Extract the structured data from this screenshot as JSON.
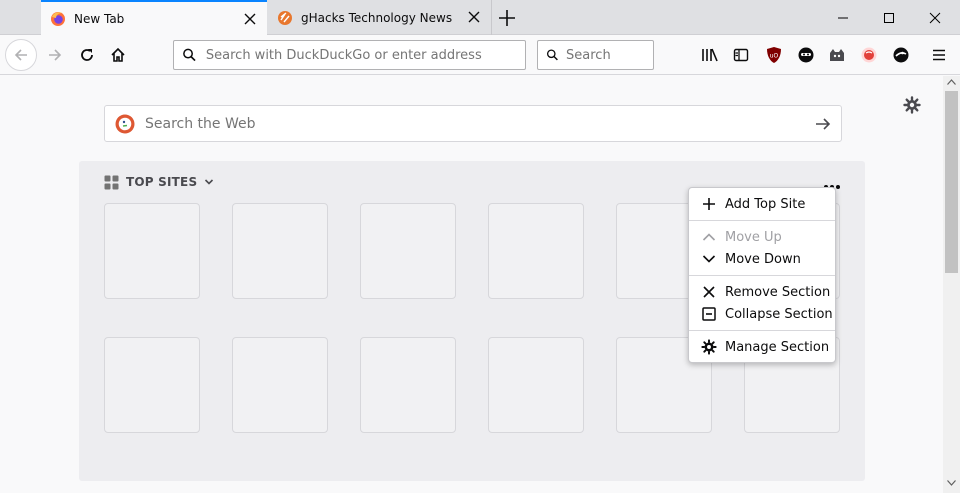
{
  "tabs": [
    {
      "label": "New Tab",
      "active": true
    },
    {
      "label": "gHacks Technology News",
      "active": false
    }
  ],
  "urlbar": {
    "placeholder": "Search with DuckDuckGo or enter address"
  },
  "searchbar": {
    "placeholder": "Search"
  },
  "content": {
    "web_search_placeholder": "Search the Web",
    "top_sites_title": "TOP SITES"
  },
  "context_menu": {
    "items": [
      {
        "label": "Add Top Site",
        "icon": "plus-icon",
        "enabled": true
      },
      {
        "label": "Move Up",
        "icon": "chevron-up-icon",
        "enabled": false
      },
      {
        "label": "Move Down",
        "icon": "chevron-down-icon",
        "enabled": true
      },
      {
        "label": "Remove Section",
        "icon": "close-icon",
        "enabled": true
      },
      {
        "label": "Collapse Section",
        "icon": "collapse-icon",
        "enabled": true
      },
      {
        "label": "Manage Section",
        "icon": "gear-icon",
        "enabled": true
      }
    ]
  },
  "colors": {
    "accent": "#0a84ff",
    "tabstrip": "#dfe0e3",
    "section_bg": "#ededf0",
    "ublock_red": "#800000",
    "duckduckgo_orange": "#de5833"
  }
}
